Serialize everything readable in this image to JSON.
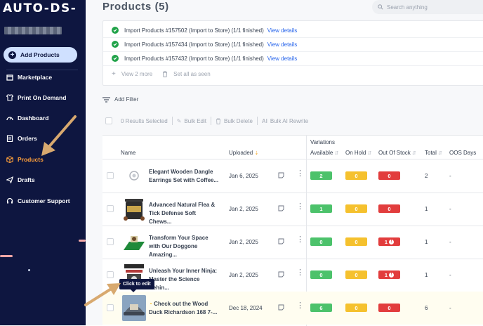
{
  "sidebar": {
    "logo": "AUTO-DS-",
    "add_products": "Add Products",
    "items": [
      {
        "label": "Marketplace",
        "icon": "store-icon"
      },
      {
        "label": "Print On Demand",
        "icon": "shirt-icon"
      },
      {
        "label": "Dashboard",
        "icon": "gauge-icon"
      },
      {
        "label": "Orders",
        "icon": "clipboard-icon"
      },
      {
        "label": "Products",
        "icon": "box-icon",
        "active": true
      },
      {
        "label": "Drafts",
        "icon": "send-icon"
      },
      {
        "label": "Customer Support",
        "icon": "headset-icon"
      }
    ]
  },
  "header": {
    "title": "Products (5)",
    "search_placeholder": "Search anything"
  },
  "notifications": {
    "items": [
      {
        "text": "Import Products #157502 (Import to Store) (1/1 finished)",
        "link": "View details"
      },
      {
        "text": "Import Products #157434 (Import to Store) (1/1 finished)",
        "link": "View details"
      },
      {
        "text": "Import Products #157432 (Import to Store) (1/1 finished)",
        "link": "View details"
      }
    ],
    "view_more": "View 2 more",
    "set_all_seen": "Set all as seen"
  },
  "toolbar": {
    "add_filter": "Add Filter",
    "results_selected": "0 Results Selected",
    "bulk_edit": "Bulk Edit",
    "bulk_delete": "Bulk Delete",
    "bulk_ai_rewrite": "Bulk AI Rewrite"
  },
  "table": {
    "headers": {
      "name": "Name",
      "uploaded": "Uploaded",
      "variations": "Variations",
      "available": "Available",
      "on_hold": "On Hold",
      "out_of_stock": "Out Of Stock",
      "total": "Total",
      "oos_days": "OOS Days"
    },
    "rows": [
      {
        "name": "Elegant Wooden Dangle Earrings Set with Coffee...",
        "uploaded": "Jan 6, 2025",
        "available": "2",
        "on_hold": "0",
        "out_of_stock": "0",
        "total": "2",
        "oos_days": "-"
      },
      {
        "name": "Advanced Natural Flea & Tick Defense Soft Chews...",
        "uploaded": "Jan 2, 2025",
        "available": "1",
        "on_hold": "0",
        "out_of_stock": "0",
        "total": "1",
        "oos_days": "-"
      },
      {
        "name": "Transform Your Space with Our Doggone Amazing...",
        "uploaded": "Jan 2, 2025",
        "available": "0",
        "on_hold": "0",
        "out_of_stock": "1",
        "total": "1",
        "oos_days": "-"
      },
      {
        "name": "Unleash Your Inner Ninja: Master the Science Behin...",
        "uploaded": "Jan 2, 2025",
        "available": "0",
        "on_hold": "0",
        "out_of_stock": "1",
        "total": "1",
        "oos_days": "-"
      },
      {
        "name": "Check out the Wood Duck Richardson 168 7-...",
        "uploaded": "Dec 18, 2024",
        "available": "6",
        "on_hold": "0",
        "out_of_stock": "0",
        "total": "6",
        "oos_days": "-"
      }
    ]
  },
  "tooltip": "Click to edit",
  "colors": {
    "sidebar_bg": "#0e1640",
    "active_nav": "#ffa03a",
    "available": "#4cc26b",
    "on_hold": "#f5c12e",
    "out_of_stock": "#e23d3d",
    "link": "#2563eb",
    "annotation_arrow": "#d8a96f"
  }
}
